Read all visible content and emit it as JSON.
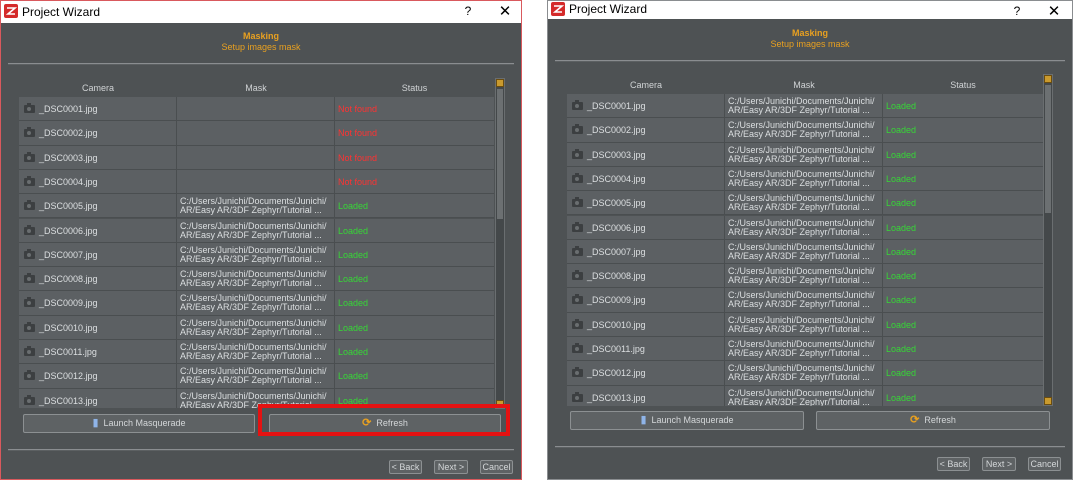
{
  "window_title": "Project Wizard",
  "help_symbol": "?",
  "close_symbol": "✕",
  "header": {
    "title": "Masking",
    "subtitle": "Setup images mask"
  },
  "table": {
    "columns": [
      "Camera",
      "Mask",
      "Status"
    ]
  },
  "mask_path": "C:/Users/Junichi/Documents/Junichi/\nAR/Easy AR/3DF Zephyr/Tutorial ...",
  "left_rows": [
    {
      "camera": "_DSC0001.jpg",
      "mask": "",
      "status": "Not found"
    },
    {
      "camera": "_DSC0002.jpg",
      "mask": "",
      "status": "Not found"
    },
    {
      "camera": "_DSC0003.jpg",
      "mask": "",
      "status": "Not found"
    },
    {
      "camera": "_DSC0004.jpg",
      "mask": "",
      "status": "Not found"
    },
    {
      "camera": "_DSC0005.jpg",
      "mask": "C:/Users/Junichi/Documents/Junichi/\nAR/Easy AR/3DF Zephyr/Tutorial ...",
      "status": "Loaded"
    },
    {
      "camera": "_DSC0006.jpg",
      "mask": "C:/Users/Junichi/Documents/Junichi/\nAR/Easy AR/3DF Zephyr/Tutorial ...",
      "status": "Loaded"
    },
    {
      "camera": "_DSC0007.jpg",
      "mask": "C:/Users/Junichi/Documents/Junichi/\nAR/Easy AR/3DF Zephyr/Tutorial ...",
      "status": "Loaded"
    },
    {
      "camera": "_DSC0008.jpg",
      "mask": "C:/Users/Junichi/Documents/Junichi/\nAR/Easy AR/3DF Zephyr/Tutorial ...",
      "status": "Loaded"
    },
    {
      "camera": "_DSC0009.jpg",
      "mask": "C:/Users/Junichi/Documents/Junichi/\nAR/Easy AR/3DF Zephyr/Tutorial ...",
      "status": "Loaded"
    },
    {
      "camera": "_DSC0010.jpg",
      "mask": "C:/Users/Junichi/Documents/Junichi/\nAR/Easy AR/3DF Zephyr/Tutorial ...",
      "status": "Loaded"
    },
    {
      "camera": "_DSC0011.jpg",
      "mask": "C:/Users/Junichi/Documents/Junichi/\nAR/Easy AR/3DF Zephyr/Tutorial ...",
      "status": "Loaded"
    },
    {
      "camera": "_DSC0012.jpg",
      "mask": "C:/Users/Junichi/Documents/Junichi/\nAR/Easy AR/3DF Zephyr/Tutorial ...",
      "status": "Loaded"
    },
    {
      "camera": "_DSC0013.jpg",
      "mask": "C:/Users/Junichi/Documents/Junichi/\nAR/Easy AR/3DF Zephyr/Tutorial ...",
      "status": "Loaded"
    }
  ],
  "right_rows": [
    {
      "camera": "_DSC0001.jpg",
      "mask": "C:/Users/Junichi/Documents/Junichi/\nAR/Easy AR/3DF Zephyr/Tutorial ...",
      "status": "Loaded"
    },
    {
      "camera": "_DSC0002.jpg",
      "mask": "C:/Users/Junichi/Documents/Junichi/\nAR/Easy AR/3DF Zephyr/Tutorial ...",
      "status": "Loaded"
    },
    {
      "camera": "_DSC0003.jpg",
      "mask": "C:/Users/Junichi/Documents/Junichi/\nAR/Easy AR/3DF Zephyr/Tutorial ...",
      "status": "Loaded"
    },
    {
      "camera": "_DSC0004.jpg",
      "mask": "C:/Users/Junichi/Documents/Junichi/\nAR/Easy AR/3DF Zephyr/Tutorial ...",
      "status": "Loaded"
    },
    {
      "camera": "_DSC0005.jpg",
      "mask": "C:/Users/Junichi/Documents/Junichi/\nAR/Easy AR/3DF Zephyr/Tutorial ...",
      "status": "Loaded"
    },
    {
      "camera": "_DSC0006.jpg",
      "mask": "C:/Users/Junichi/Documents/Junichi/\nAR/Easy AR/3DF Zephyr/Tutorial ...",
      "status": "Loaded"
    },
    {
      "camera": "_DSC0007.jpg",
      "mask": "C:/Users/Junichi/Documents/Junichi/\nAR/Easy AR/3DF Zephyr/Tutorial ...",
      "status": "Loaded"
    },
    {
      "camera": "_DSC0008.jpg",
      "mask": "C:/Users/Junichi/Documents/Junichi/\nAR/Easy AR/3DF Zephyr/Tutorial ...",
      "status": "Loaded"
    },
    {
      "camera": "_DSC0009.jpg",
      "mask": "C:/Users/Junichi/Documents/Junichi/\nAR/Easy AR/3DF Zephyr/Tutorial ...",
      "status": "Loaded"
    },
    {
      "camera": "_DSC0010.jpg",
      "mask": "C:/Users/Junichi/Documents/Junichi/\nAR/Easy AR/3DF Zephyr/Tutorial ...",
      "status": "Loaded"
    },
    {
      "camera": "_DSC0011.jpg",
      "mask": "C:/Users/Junichi/Documents/Junichi/\nAR/Easy AR/3DF Zephyr/Tutorial ...",
      "status": "Loaded"
    },
    {
      "camera": "_DSC0012.jpg",
      "mask": "C:/Users/Junichi/Documents/Junichi/\nAR/Easy AR/3DF Zephyr/Tutorial ...",
      "status": "Loaded"
    },
    {
      "camera": "_DSC0013.jpg",
      "mask": "C:/Users/Junichi/Documents/Junichi/\nAR/Easy AR/3DF Zephyr/Tutorial ...",
      "status": "Loaded"
    }
  ],
  "buttons": {
    "launch": "Launch Masquerade",
    "refresh": "Refresh",
    "back": "< Back",
    "next": "Next >",
    "cancel": "Cancel"
  },
  "colors": {
    "accent": "#e8a020",
    "loaded": "#37d637",
    "not_found": "#ff3232",
    "highlight": "#e41212"
  },
  "icons": {
    "app": "zephyr-logo-icon",
    "camera": "camera-icon",
    "launch": "masquerade-icon",
    "refresh": "refresh-icon"
  }
}
